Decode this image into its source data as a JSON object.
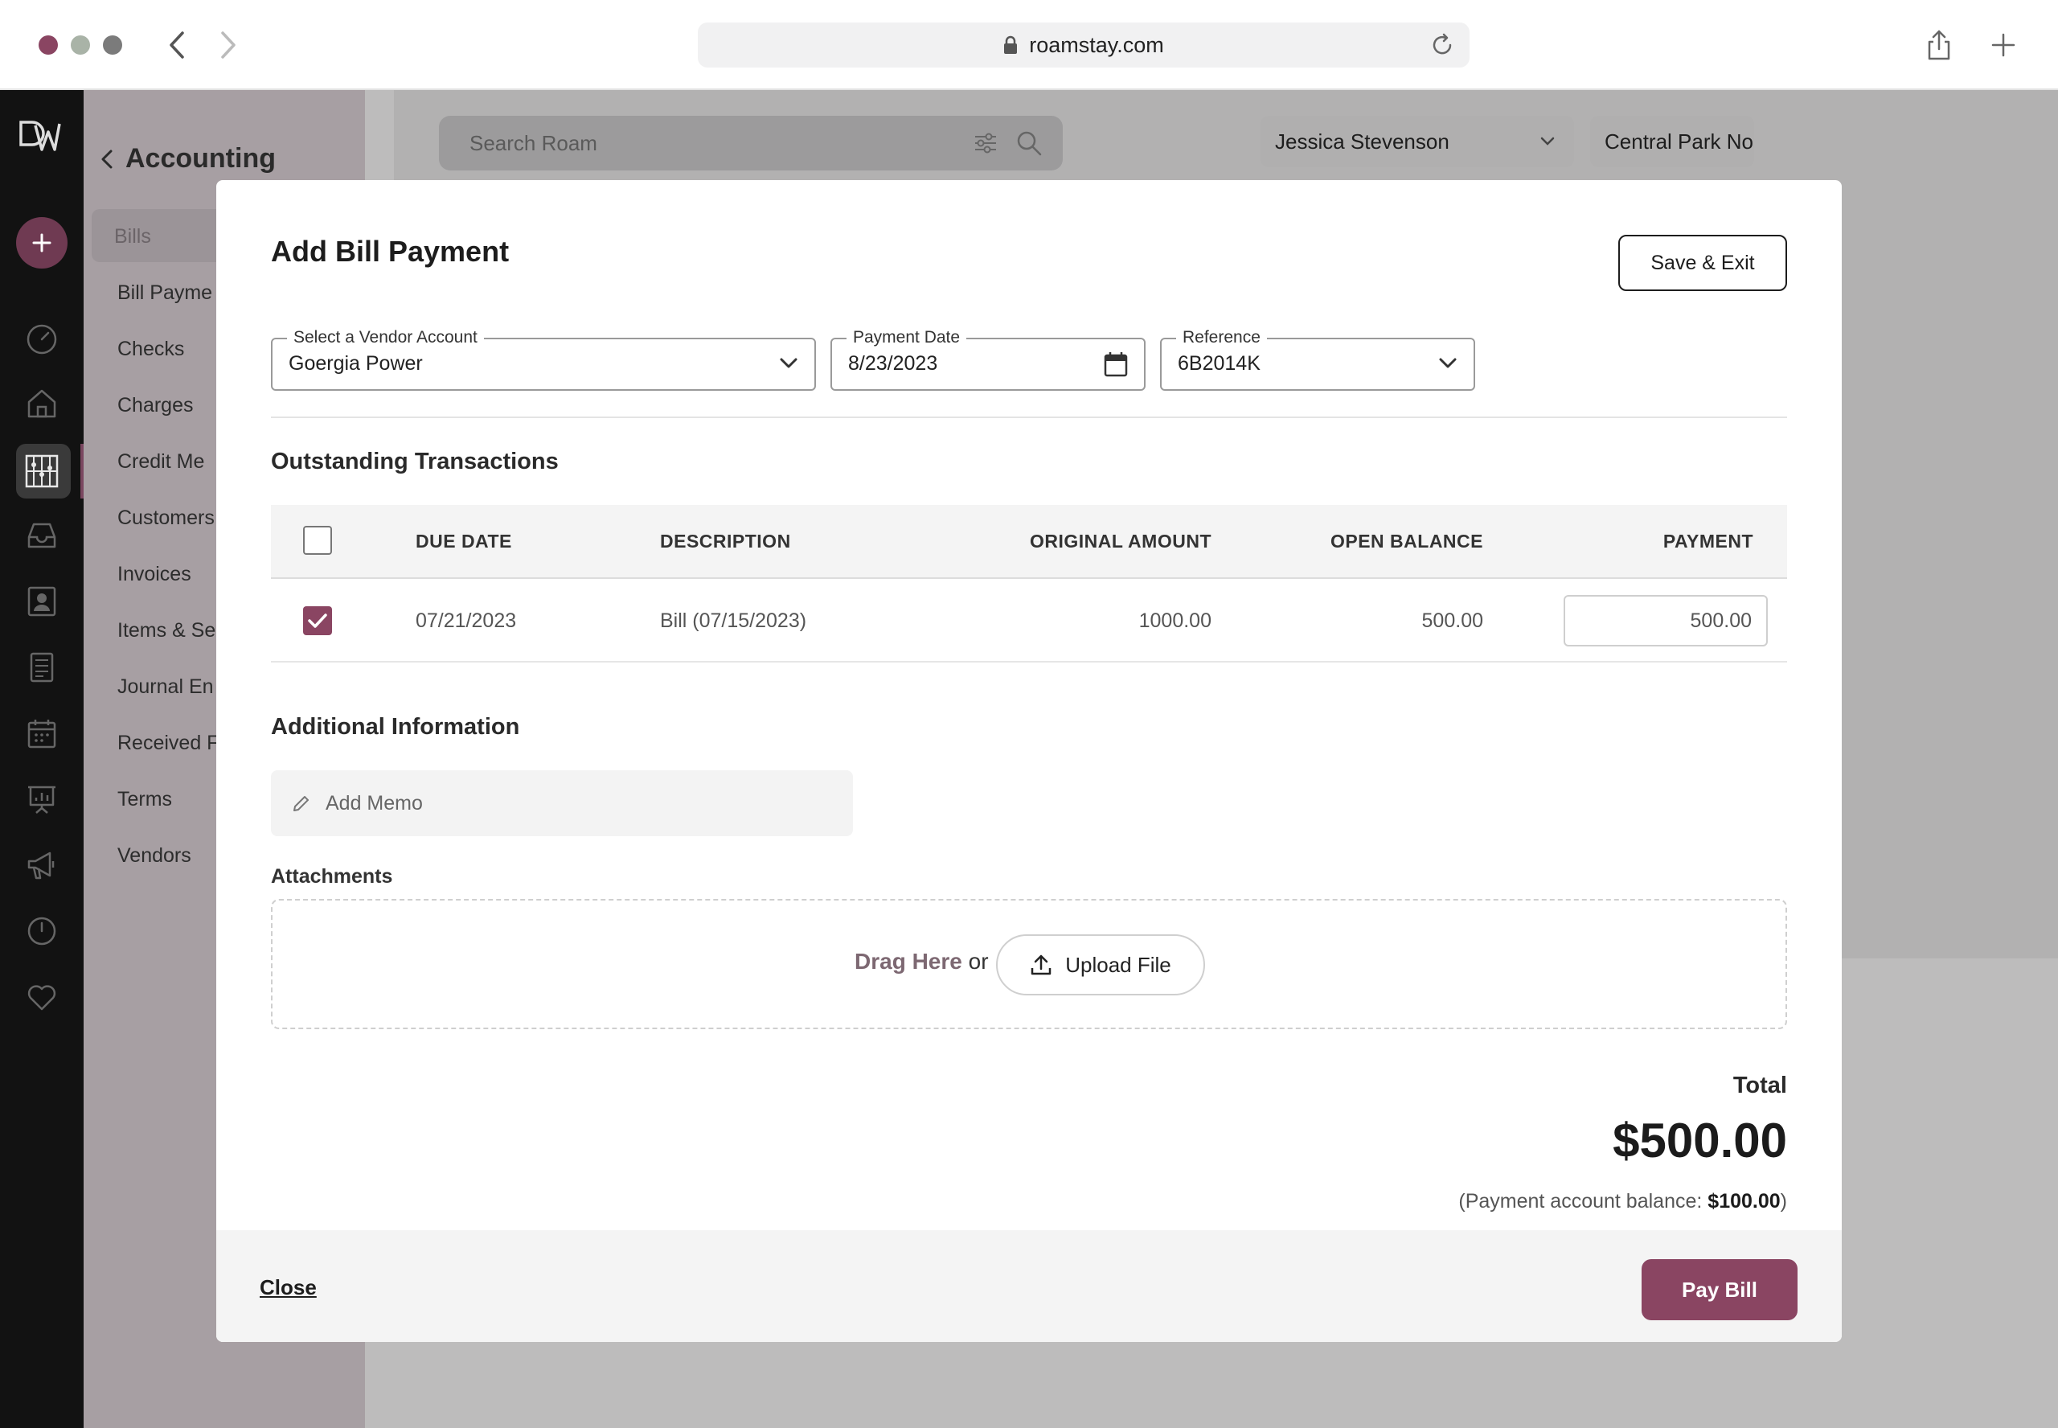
{
  "browser": {
    "url": "roamstay.com"
  },
  "colors": {
    "accent": "#8a4562",
    "rail": "#121212",
    "sidebar": "#a79fa3"
  },
  "rail": {
    "icons": [
      "logo-icon",
      "add-icon",
      "dashboard-icon",
      "home-icon",
      "accounting-icon",
      "inbox-icon",
      "contacts-icon",
      "reports-icon",
      "calendar-icon",
      "presentation-icon",
      "megaphone-icon",
      "clock-icon",
      "heart-icon"
    ]
  },
  "sidebar": {
    "title": "Accounting",
    "items": [
      {
        "label": "Bills"
      },
      {
        "label": "Bill Payme"
      },
      {
        "label": "Checks"
      },
      {
        "label": "Charges"
      },
      {
        "label": "Credit Me"
      },
      {
        "label": "Customers"
      },
      {
        "label": "Invoices"
      },
      {
        "label": "Items & Se"
      },
      {
        "label": "Journal En"
      },
      {
        "label": "Received F"
      },
      {
        "label": "Terms"
      },
      {
        "label": "Vendors"
      }
    ]
  },
  "topbar": {
    "search_placeholder": "Search Roam",
    "user": "Jessica Stevenson",
    "property": "Central Park No"
  },
  "modal": {
    "title": "Add Bill Payment",
    "save_exit": "Save & Exit",
    "vendor": {
      "label": "Select a Vendor Account",
      "value": "Goergia Power"
    },
    "payment_date": {
      "label": "Payment Date",
      "value": "8/23/2023"
    },
    "reference": {
      "label": "Reference",
      "value": "6B2014K"
    },
    "outstanding_title": "Outstanding Transactions",
    "table": {
      "headers": {
        "due_date": "DUE DATE",
        "description": "DESCRIPTION",
        "original_amount": "ORIGINAL AMOUNT",
        "open_balance": "OPEN BALANCE",
        "payment": "PAYMENT"
      },
      "rows": [
        {
          "checked": true,
          "due_date": "07/21/2023",
          "description": "Bill (07/15/2023)",
          "original_amount": "1000.00",
          "open_balance": "500.00",
          "payment": "500.00"
        }
      ]
    },
    "additional_title": "Additional Information",
    "memo_placeholder": "Add Memo",
    "attachments_label": "Attachments",
    "drag_here": "Drag Here",
    "drag_or": "or",
    "upload_file": "Upload File",
    "total_label": "Total",
    "total_amount": "$500.00",
    "balance_prefix": "(Payment account balance:",
    "balance_value": "$100.00",
    "balance_suffix": ")",
    "close": "Close",
    "pay_bill": "Pay Bill"
  }
}
